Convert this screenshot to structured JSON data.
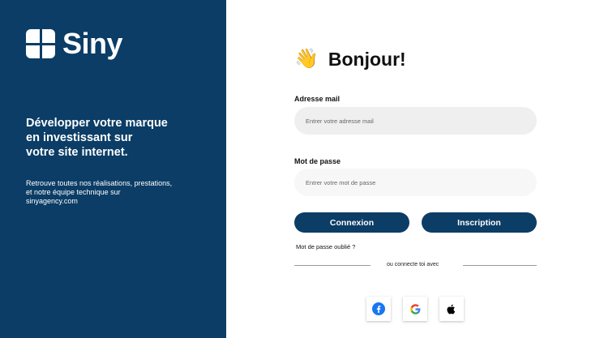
{
  "brand": {
    "name": "Siny"
  },
  "left_panel": {
    "headline": "Développer votre marque\nen investissant sur\nvotre site internet.",
    "description": "Retrouve toutes nos réalisations, prestations,\net notre équipe technique sur\nsinyagency.com"
  },
  "login": {
    "greeting": "Bonjour!",
    "email_label": "Adresse mail",
    "email_placeholder": "Entrer votre adresse mail",
    "password_label": "Mot de passe",
    "password_placeholder": "Entrer votre mot de passe",
    "login_button": "Connexion",
    "signup_button": "Inscription",
    "forgot_password": "Mot de passe oublié ?",
    "divider_text": "ou connecte toi avec"
  },
  "colors": {
    "brand_navy": "#0b3d66",
    "email_bg": "#efefef",
    "password_bg": "#f7f7f7",
    "facebook_blue": "#1877f2"
  },
  "icons": [
    "waving-hand-icon",
    "facebook-icon",
    "google-icon",
    "apple-icon"
  ]
}
